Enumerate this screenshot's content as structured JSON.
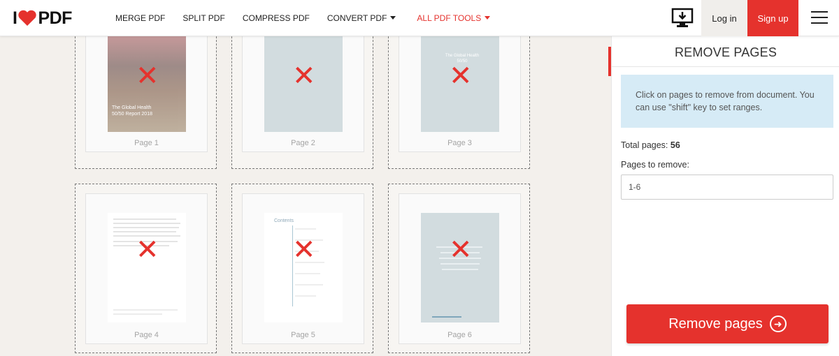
{
  "brand": {
    "logo_left": "I",
    "logo_right": "PDF",
    "accent": "#e5322d"
  },
  "nav": {
    "items": [
      {
        "label": "MERGE PDF"
      },
      {
        "label": "SPLIT PDF"
      },
      {
        "label": "COMPRESS PDF"
      },
      {
        "label": "CONVERT PDF"
      },
      {
        "label": "ALL PDF TOOLS"
      }
    ]
  },
  "header": {
    "login": "Log in",
    "signup": "Sign up"
  },
  "pages": [
    {
      "label": "Page 1",
      "cover_text": "The Global Health 50/50 Report 2018"
    },
    {
      "label": "Page 2"
    },
    {
      "label": "Page 3",
      "cover_text": "The Global Health 50/50"
    },
    {
      "label": "Page 4"
    },
    {
      "label": "Page 5",
      "cover_text": "Contents"
    },
    {
      "label": "Page 6"
    }
  ],
  "sidebar": {
    "title": "REMOVE PAGES",
    "info": "Click on pages to remove from document. You can use \"shift\" key to set ranges.",
    "total_label": "Total pages:",
    "total_value": "56",
    "remove_label": "Pages to remove:",
    "remove_value": "1-6",
    "button": "Remove pages"
  }
}
